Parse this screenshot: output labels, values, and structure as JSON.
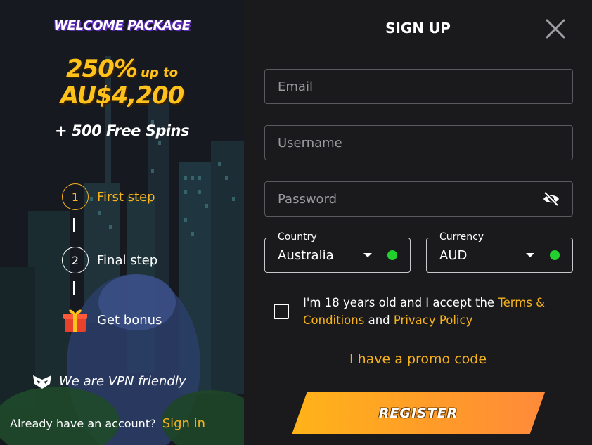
{
  "promo": {
    "welcome": "WELCOME PACKAGE",
    "percent": "250%",
    "up_to": "up to",
    "amount": "AU$4,200",
    "spins": "+ 500 Free Spins",
    "steps": [
      {
        "number": "1",
        "label": "First step"
      },
      {
        "number": "2",
        "label": "Final step"
      },
      {
        "label": "Get bonus"
      }
    ],
    "vpn": "We are VPN friendly",
    "already": "Already have an account?",
    "signin": "Sign in"
  },
  "form": {
    "title": "SIGN UP",
    "email_placeholder": "Email",
    "username_placeholder": "Username",
    "password_placeholder": "Password",
    "country": {
      "legend": "Country",
      "value": "Australia"
    },
    "currency": {
      "legend": "Currency",
      "value": "AUD"
    },
    "terms_prefix": "I'm 18 years old and I accept the",
    "terms_link": "Terms & Conditions",
    "terms_and": "and",
    "privacy_link": "Privacy Policy",
    "promo_code": "I have a promo code",
    "register": "REGISTER"
  },
  "colors": {
    "accent": "#f7b31d",
    "status_ok": "#22d12e",
    "background": "#1a1a1d"
  }
}
